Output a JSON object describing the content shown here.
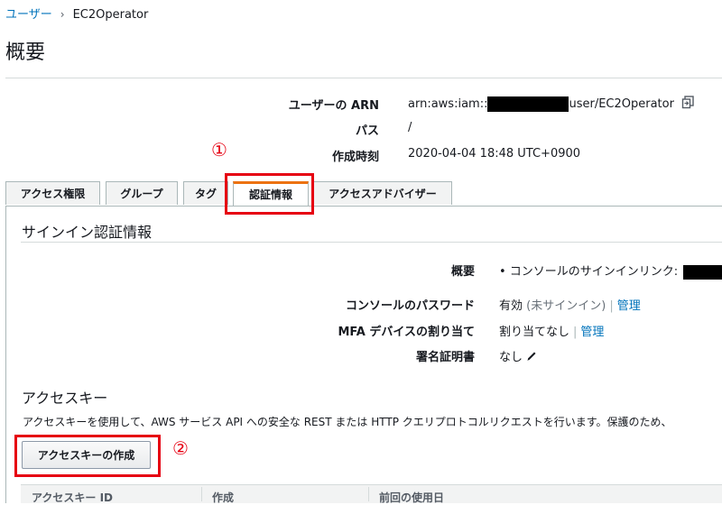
{
  "breadcrumb": {
    "parent": "ユーザー",
    "separator": "›",
    "current": "EC2Operator"
  },
  "page_title": "概要",
  "summary": {
    "arn_label": "ユーザーの ARN",
    "arn_prefix": "arn:aws:iam::",
    "arn_suffix": "user/EC2Operator",
    "path_label": "パス",
    "path_value": "/",
    "created_label": "作成時刻",
    "created_value": "2020-04-04 18:48 UTC+0900"
  },
  "annotations": {
    "marker1": "①",
    "marker2": "②"
  },
  "tabs": [
    {
      "label": "アクセス権限"
    },
    {
      "label": "グループ"
    },
    {
      "label": "タグ"
    },
    {
      "label": "認証情報",
      "active": true
    },
    {
      "label": "アクセスアドバイザー"
    }
  ],
  "signin": {
    "title": "サインイン認証情報",
    "summary_label": "概要",
    "summary_value": "• コンソールのサインインリンク:",
    "password_label": "コンソールのパスワード",
    "password_status": "有効",
    "password_note": "(未サインイン)",
    "password_link": "管理",
    "mfa_label": "MFA デバイスの割り当て",
    "mfa_value": "割り当てなし",
    "mfa_link": "管理",
    "cert_label": "署名証明書",
    "cert_value": "なし"
  },
  "access_keys": {
    "title": "アクセスキー",
    "description": "アクセスキーを使用して、AWS サービス API への安全な REST または HTTP クエリプロトコルリクエストを行います。保護のため、",
    "create_button": "アクセスキーの作成",
    "columns": [
      "アクセスキー ID",
      "作成",
      "前回の使用日"
    ]
  },
  "colors": {
    "link": "#0073bb",
    "active_tab_accent": "#ec7211",
    "annotation_red": "#e60012"
  }
}
